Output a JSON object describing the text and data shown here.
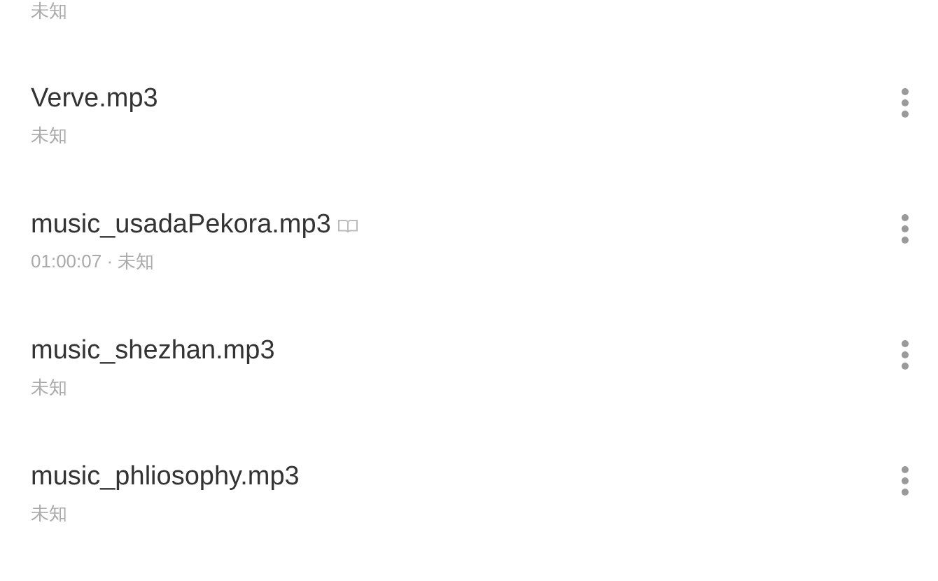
{
  "songs": [
    {
      "kind": "partial",
      "subtitle": "未知"
    },
    {
      "kind": "full",
      "title": "Verve.mp3",
      "subtitle": "未知",
      "book_mark": false
    },
    {
      "kind": "full",
      "title": "music_usadaPekora.mp3",
      "subtitle": "01:00:07 · 未知",
      "book_mark": true
    },
    {
      "kind": "full",
      "title": "music_shezhan.mp3",
      "subtitle": "未知",
      "book_mark": false
    },
    {
      "kind": "full",
      "title": "music_phliosophy.mp3",
      "subtitle": "未知",
      "book_mark": false
    }
  ]
}
